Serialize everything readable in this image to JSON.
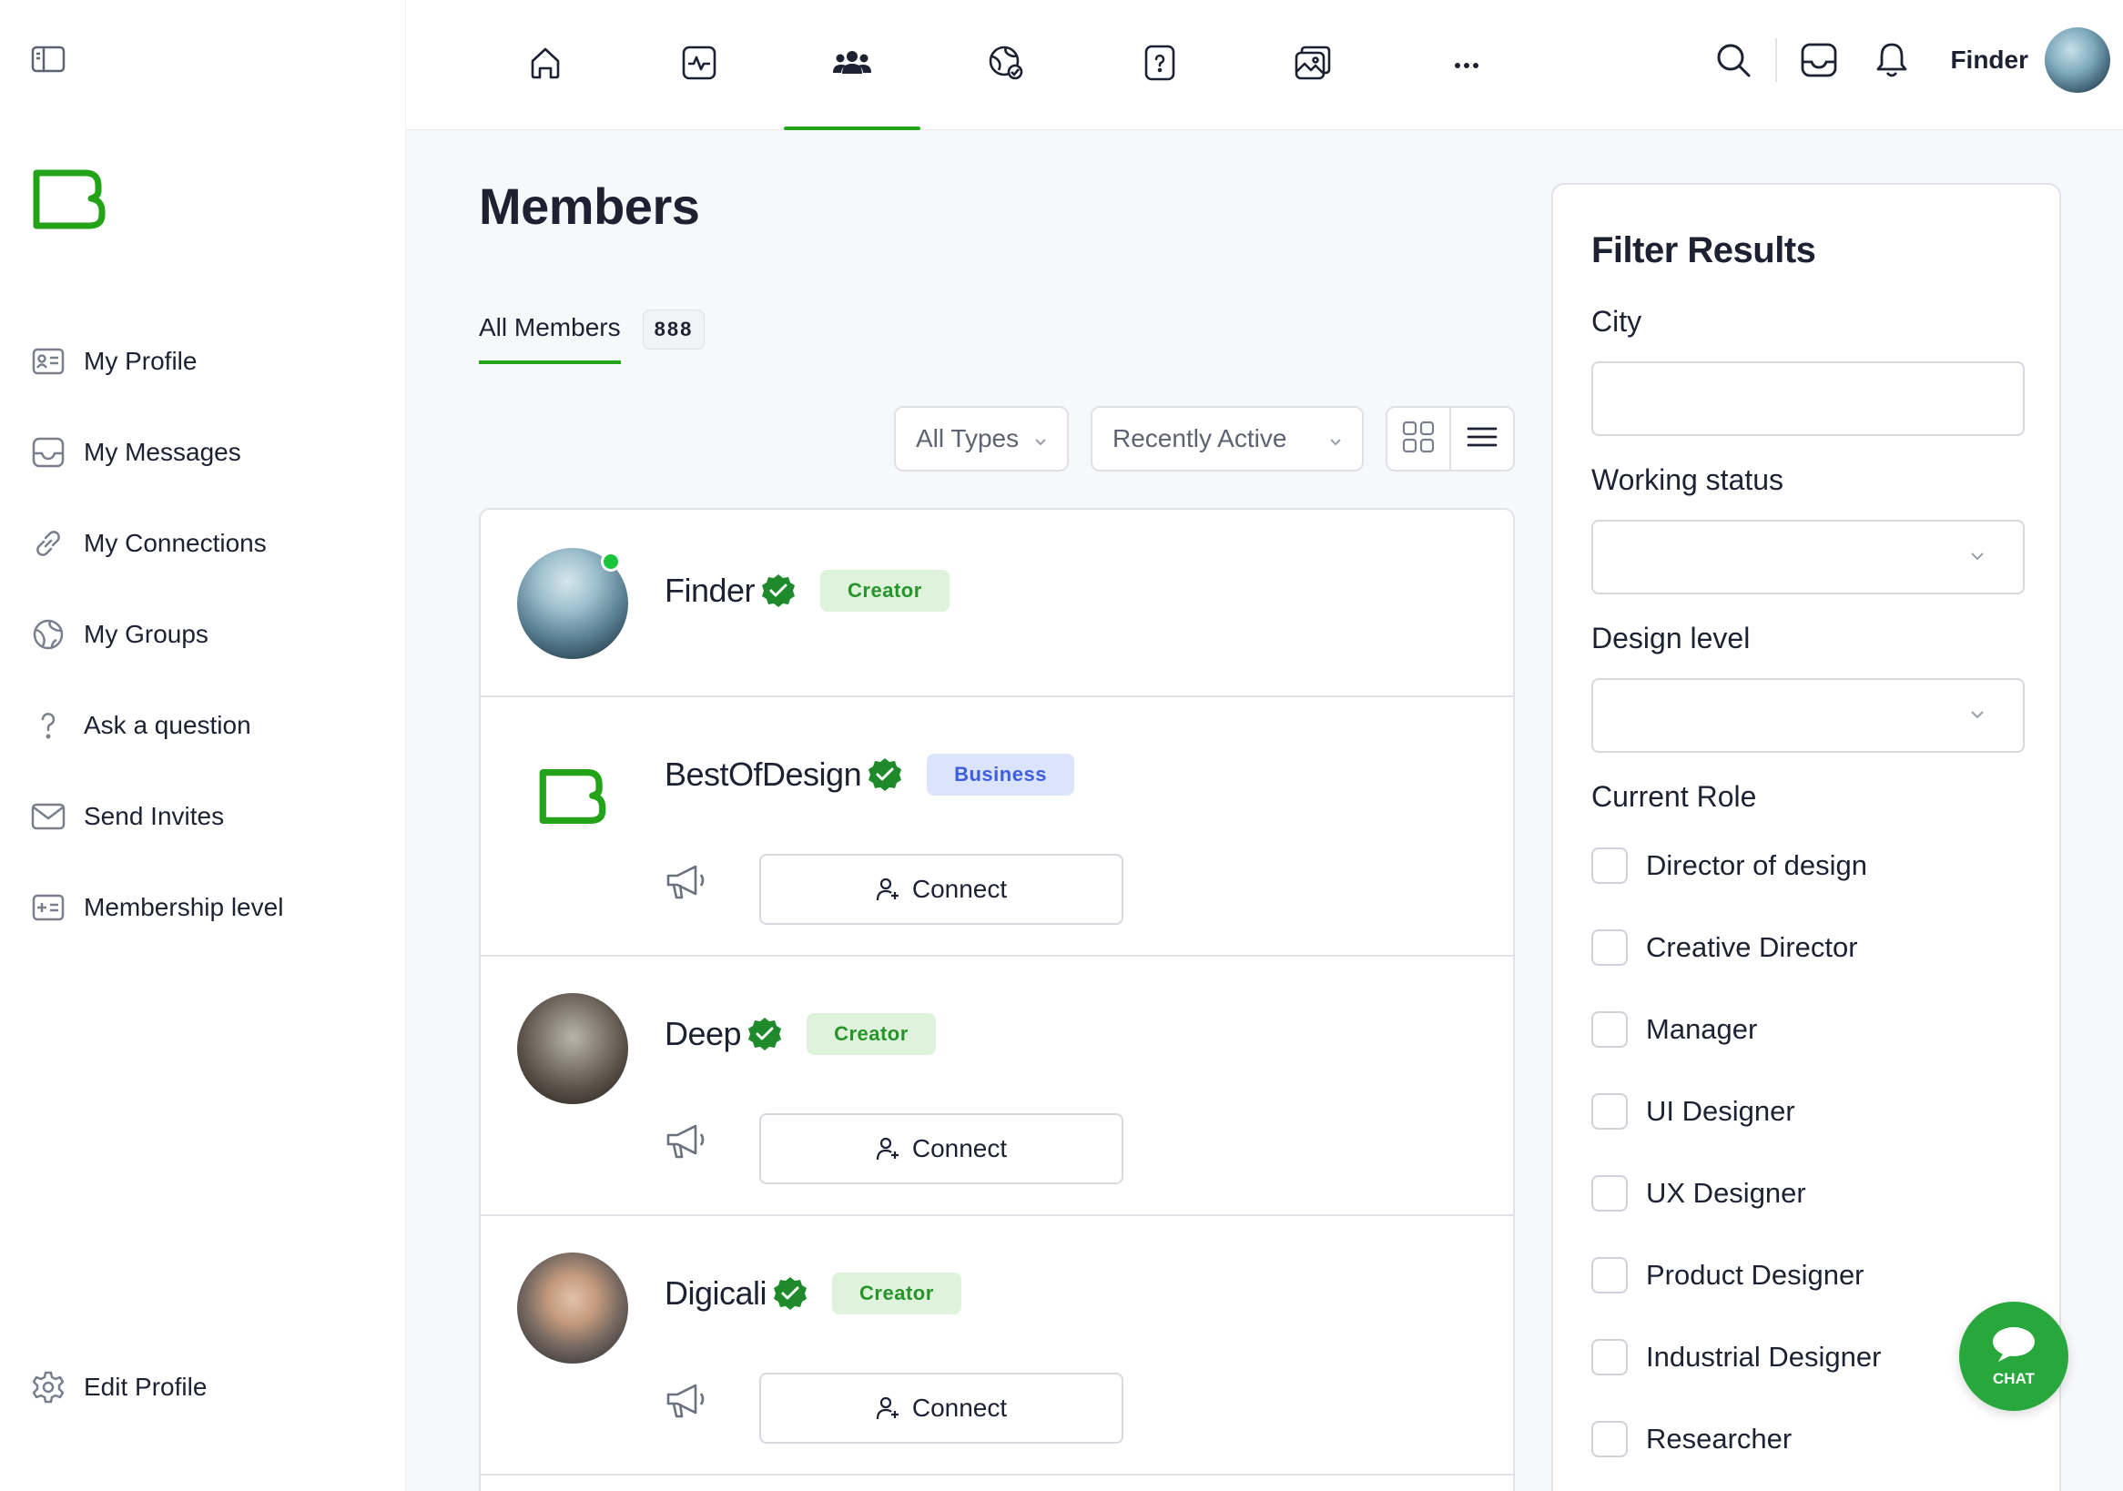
{
  "sidebar": {
    "items": [
      {
        "label": "My Profile",
        "icon": "id-card-icon"
      },
      {
        "label": "My Messages",
        "icon": "inbox-icon"
      },
      {
        "label": "My Connections",
        "icon": "link-icon"
      },
      {
        "label": "My Groups",
        "icon": "globe-icon"
      },
      {
        "label": "Ask a question",
        "icon": "question-icon"
      },
      {
        "label": "Send Invites",
        "icon": "envelope-icon"
      },
      {
        "label": "Membership level",
        "icon": "membership-card-icon"
      }
    ],
    "edit_profile": "Edit Profile"
  },
  "topbar": {
    "user_name": "Finder",
    "nav": [
      "home-icon",
      "activity-icon",
      "members-icon",
      "groups-globe-icon",
      "question-icon",
      "photos-icon",
      "more-icon"
    ],
    "active_nav": "members-icon"
  },
  "main": {
    "title": "Members",
    "tab": {
      "label": "All Members",
      "count": "888"
    },
    "type_filter": "All Types",
    "sort_filter": "Recently Active"
  },
  "members": [
    {
      "name": "Finder",
      "badge": "Creator",
      "badge_type": "creator",
      "online": true
    },
    {
      "name": "BestOfDesign",
      "badge": "Business",
      "badge_type": "business",
      "connect": "Connect"
    },
    {
      "name": "Deep",
      "badge": "Creator",
      "badge_type": "creator",
      "connect": "Connect"
    },
    {
      "name": "Digicali",
      "badge": "Creator",
      "badge_type": "creator",
      "connect": "Connect"
    }
  ],
  "filter": {
    "title": "Filter Results",
    "city_label": "City",
    "working_status_label": "Working status",
    "design_level_label": "Design level",
    "current_role_label": "Current Role",
    "roles": [
      "Director of design",
      "Creative Director",
      "Manager",
      "UI Designer",
      "UX Designer",
      "Product Designer",
      "Industrial Designer",
      "Researcher"
    ]
  },
  "chat": {
    "label": "CHAT"
  },
  "colors": {
    "accent": "#22a318",
    "creator_bg": "#dff3dc",
    "business_bg": "#dce4fb"
  }
}
